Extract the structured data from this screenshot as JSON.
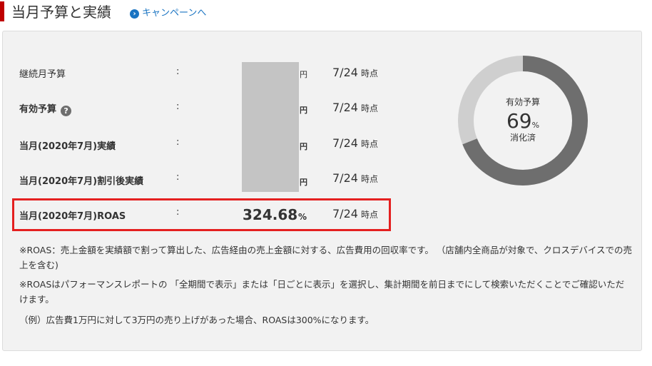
{
  "header": {
    "title": "当月予算と実績",
    "campaign_link": "キャンペーンへ"
  },
  "rows": [
    {
      "label": "継続月予算",
      "colon": ":",
      "unit": "円",
      "date": "7/24",
      "date_suffix": "時点"
    },
    {
      "label": "有効予算",
      "colon": ":",
      "unit": "円",
      "date": "7/24",
      "date_suffix": "時点"
    },
    {
      "label": "当月(2020年7月)実績",
      "colon": ":",
      "unit": "円",
      "date": "7/24",
      "date_suffix": "時点"
    },
    {
      "label": "当月(2020年7月)割引後実績",
      "colon": ":",
      "unit": "円",
      "date": "7/24",
      "date_suffix": "時点"
    },
    {
      "label": "当月(2020年7月)ROAS",
      "colon": ":",
      "value": "324.68",
      "unit": "%",
      "date": "7/24",
      "date_suffix": "時点"
    }
  ],
  "notes": [
    "※ROAS：売上金額を実績額で割って算出した、広告経由の売上金額に対する、広告費用の回収率です。 （店舗内全商品が対象で、クロスデバイスでの売上を含む)",
    "※ROASはパフォーマンスレポートの 「全期間で表示」または「日ごとに表示」を選択し、集計期間を前日までにして検索いただくことでご確認いただけます。",
    "（例）広告費1万円に対して3万円の売り上げがあった場合、ROASは300%になります。"
  ],
  "donut": {
    "label_top": "有効予算",
    "percent": "69",
    "percent_sign": "%",
    "label_bottom": "消化済",
    "fraction": 0.69,
    "color_used": "#6e6e6e",
    "color_remaining": "#cfcfcf"
  },
  "colors": {
    "accent": "#bf0000",
    "link": "#1a74c2",
    "highlight_border": "#e42020"
  }
}
